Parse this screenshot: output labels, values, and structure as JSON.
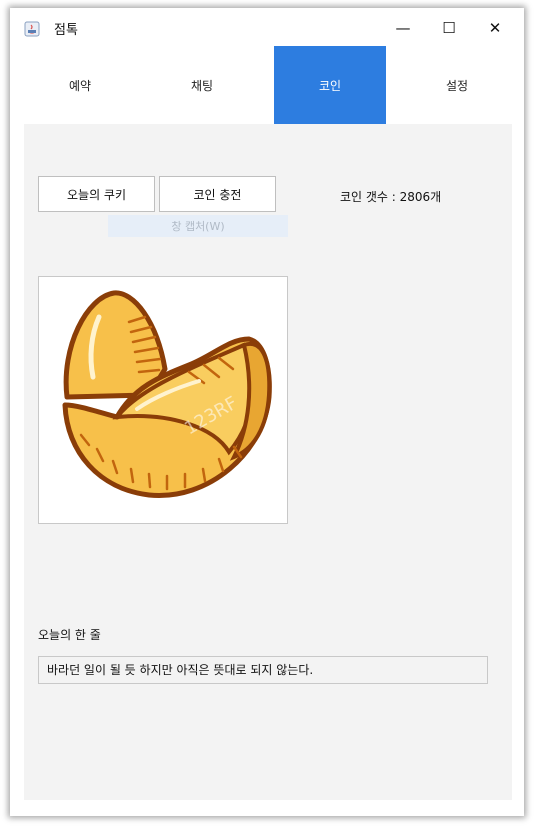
{
  "window": {
    "title": "점톡",
    "minimize_glyph": "—",
    "maximize_glyph": "☐",
    "close_glyph": "✕"
  },
  "tabs": [
    {
      "label": "예약",
      "active": false
    },
    {
      "label": "채팅",
      "active": false
    },
    {
      "label": "코인",
      "active": true
    },
    {
      "label": "설정",
      "active": false
    }
  ],
  "coin": {
    "cookie_button": "오늘의 쿠키",
    "charge_button": "코인 충전",
    "count_text": "코인 갯수 : 2806개",
    "capture_hint": "창 캡처(W)"
  },
  "image": {
    "icon": "fortune-cookie-icon",
    "watermark": "123RF"
  },
  "quote": {
    "label": "오늘의 한 줄",
    "value": "바라던 일이 될 듯 하지만 아직은 뜻대로 되지 않는다."
  },
  "colors": {
    "accent": "#2d7de0",
    "panel_bg": "#f3f3f3",
    "cookie_fill": "#f7c04a",
    "cookie_outline": "#c2650e"
  }
}
